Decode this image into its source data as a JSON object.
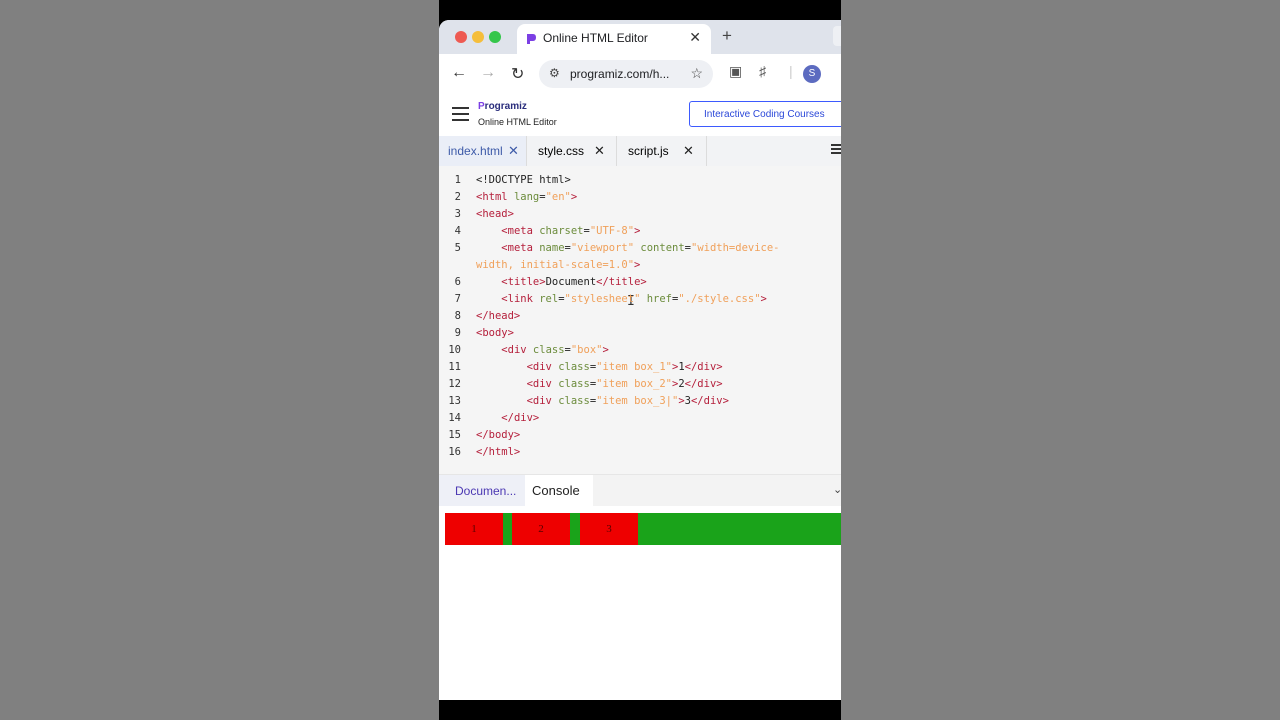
{
  "browser": {
    "tab_title": "Online HTML Editor",
    "tab_close": "✕",
    "new_tab": "+",
    "url": "programiz.com/h...",
    "profile_initial": "S",
    "favicon_color": "#7b3fe4"
  },
  "site": {
    "logo_first": "P",
    "logo_rest": "rogramiz",
    "subtitle": "Online HTML Editor",
    "courses_button": "Interactive Coding Courses"
  },
  "editor": {
    "tabs": [
      {
        "label": "index.html",
        "close": "✕"
      },
      {
        "label": "style.css",
        "close": "✕"
      },
      {
        "label": "script.js",
        "close": "✕"
      }
    ],
    "lines": [
      {
        "n": "1",
        "html": "<span style='color:#222'>&lt;!DOCTYPE html&gt;</span>"
      },
      {
        "n": "2",
        "html": "<span style='color:#b5203c'>&lt;html</span> <span style='color:#6c8c3c'>lang</span>=<span style='color:#f0a05a'>\"en\"</span><span style='color:#b5203c'>&gt;</span>"
      },
      {
        "n": "3",
        "html": "<span style='color:#b5203c'>&lt;head&gt;</span>"
      },
      {
        "n": "4",
        "html": "    <span style='color:#b5203c'>&lt;meta</span> <span style='color:#6c8c3c'>charset</span>=<span style='color:#f0a05a'>\"UTF-8\"</span><span style='color:#b5203c'>&gt;</span>"
      },
      {
        "n": "5",
        "html": "    <span style='color:#b5203c'>&lt;meta</span> <span style='color:#6c8c3c'>name</span>=<span style='color:#f0a05a'>\"viewport\"</span> <span style='color:#6c8c3c'>content</span>=<span style='color:#f0a05a'>\"width=device-</span>"
      },
      {
        "n": "",
        "html": "<span style='color:#f0a05a'>width, initial-scale=1.0\"</span><span style='color:#b5203c'>&gt;</span>"
      },
      {
        "n": "6",
        "html": "    <span style='color:#b5203c'>&lt;title&gt;</span>Document<span style='color:#b5203c'>&lt;/title&gt;</span>"
      },
      {
        "n": "7",
        "html": "    <span style='color:#b5203c'>&lt;link</span> <span style='color:#6c8c3c'>rel</span>=<span style='color:#f0a05a'>\"stylesheet\"</span> <span style='color:#6c8c3c'>href</span>=<span style='color:#f0a05a'>\"./style.css\"</span><span style='color:#b5203c'>&gt;</span>"
      },
      {
        "n": "8",
        "html": "<span style='color:#b5203c'>&lt;/head&gt;</span>"
      },
      {
        "n": "9",
        "html": "<span style='color:#b5203c'>&lt;body&gt;</span>"
      },
      {
        "n": "10",
        "html": "    <span style='color:#b5203c'>&lt;div</span> <span style='color:#6c8c3c'>class</span>=<span style='color:#f0a05a'>\"box\"</span><span style='color:#b5203c'>&gt;</span>"
      },
      {
        "n": "11",
        "html": "        <span style='color:#b5203c'>&lt;div</span> <span style='color:#6c8c3c'>class</span>=<span style='color:#f0a05a'>\"item box_1\"</span><span style='color:#b5203c'>&gt;</span>1<span style='color:#b5203c'>&lt;/div&gt;</span>"
      },
      {
        "n": "12",
        "html": "        <span style='color:#b5203c'>&lt;div</span> <span style='color:#6c8c3c'>class</span>=<span style='color:#f0a05a'>\"item box_2\"</span><span style='color:#b5203c'>&gt;</span>2<span style='color:#b5203c'>&lt;/div&gt;</span>"
      },
      {
        "n": "13",
        "html": "        <span style='color:#b5203c'>&lt;div</span> <span style='color:#6c8c3c'>class</span>=<span style='color:#f0a05a'>\"item box_3|\"</span><span style='color:#b5203c'>&gt;</span>3<span style='color:#b5203c'>&lt;/div&gt;</span>"
      },
      {
        "n": "14",
        "html": "    <span style='color:#b5203c'>&lt;/div&gt;</span>"
      },
      {
        "n": "15",
        "html": "<span style='color:#b5203c'>&lt;/body&gt;</span>"
      },
      {
        "n": "16",
        "html": "<span style='color:#b5203c'>&lt;/html&gt;</span>"
      }
    ]
  },
  "output": {
    "tab_document": "Documen...",
    "tab_console": "Console",
    "items": [
      "1",
      "2",
      "3"
    ],
    "box_color": "#1aa31a",
    "item_color": "#ee0000"
  }
}
